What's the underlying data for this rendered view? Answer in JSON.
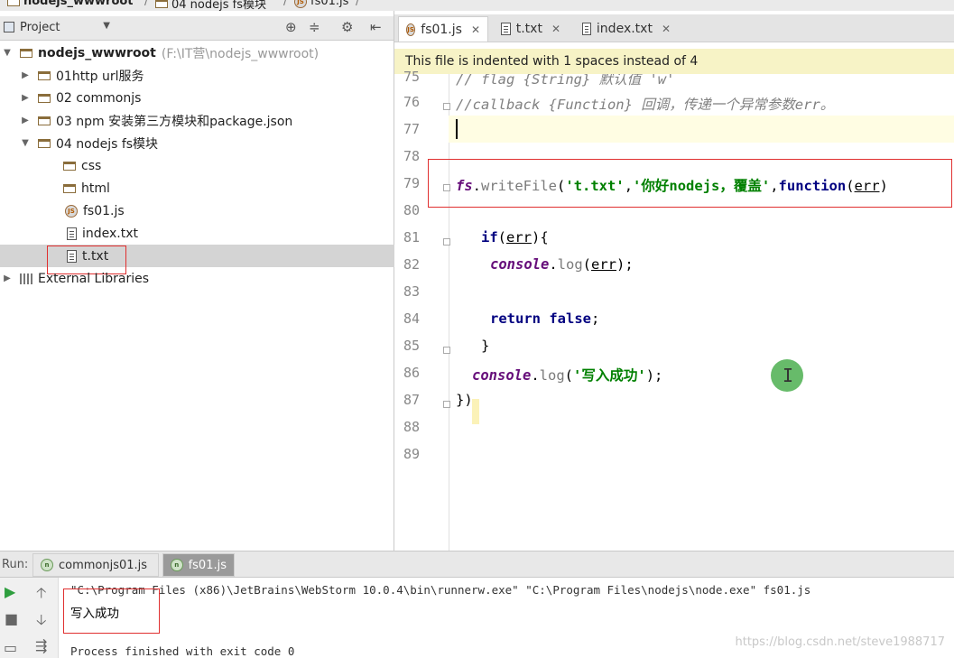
{
  "breadcrumb": [
    {
      "label": "nodejs_wwwroot",
      "icon": "folder-icon"
    },
    {
      "label": "04 nodejs fs模块",
      "icon": "folder-icon"
    },
    {
      "label": "fs01.js",
      "icon": "js-file-icon"
    }
  ],
  "project_panel": {
    "selector_label": "Project",
    "tree": [
      {
        "label": "nodejs_wwwroot",
        "note": "(F:\\IT营\\nodejs_wwwroot)",
        "icon": "folder-icon",
        "expanded": true,
        "level": 0
      },
      {
        "label": "01http url服务",
        "icon": "folder-icon",
        "level": 1
      },
      {
        "label": "02 commonjs",
        "icon": "folder-icon",
        "level": 1
      },
      {
        "label": "03 npm 安装第三方模块和package.json",
        "icon": "folder-icon",
        "level": 1
      },
      {
        "label": "04 nodejs fs模块",
        "icon": "folder-icon",
        "expanded": true,
        "level": 1
      },
      {
        "label": "css",
        "icon": "folder-icon",
        "level": 2
      },
      {
        "label": "html",
        "icon": "folder-icon",
        "level": 2
      },
      {
        "label": "fs01.js",
        "icon": "js-file-icon",
        "level": 2
      },
      {
        "label": "index.txt",
        "icon": "text-file-icon",
        "level": 2
      },
      {
        "label": "t.txt",
        "icon": "text-file-icon",
        "level": 2,
        "selected": true
      },
      {
        "label": "External Libraries",
        "icon": "library-icon",
        "level": 0
      }
    ]
  },
  "editor": {
    "tabs": [
      {
        "label": "fs01.js",
        "icon": "js-file-icon",
        "active": true
      },
      {
        "label": "t.txt",
        "icon": "text-file-icon"
      },
      {
        "label": "index.txt",
        "icon": "text-file-icon"
      }
    ],
    "notice": "This file is indented with 1 spaces instead of 4",
    "line_numbers": [
      "75",
      "76",
      "77",
      "78",
      "79",
      "80",
      "81",
      "82",
      "83",
      "84",
      "85",
      "86",
      "87",
      "88",
      "89"
    ],
    "code": {
      "l75": "//   flag           {String}       默认值 'w'",
      "l76": "//callback {Function}  回调，传递一个异常参数err。",
      "l79": {
        "obj": "fs",
        "dot": ".",
        "fn": "writeFile",
        "p1": "(",
        "s1": "'t.txt'",
        "c1": ",",
        "s2": "'你好nodejs，覆盖'",
        "c2": ",",
        "kw": "function",
        "p2": "(",
        "arg": "err",
        "p3": ")"
      },
      "l81": {
        "kw": "if",
        "p1": "(",
        "arg": "err",
        "p2": "){"
      },
      "l82": {
        "obj": "console",
        "dot": ".",
        "fn": "log",
        "p1": "(",
        "arg": "err",
        "p2": ");"
      },
      "l84": {
        "kw1": "return",
        "kw2": "false",
        "semi": ";"
      },
      "l85": "}",
      "l86": {
        "obj": "console",
        "dot": ".",
        "fn": "log",
        "p1": "(",
        "s": "'写入成功'",
        "p2": ");"
      },
      "l87": "})"
    }
  },
  "run_panel": {
    "label": "Run:",
    "tabs": [
      {
        "label": "commonjs01.js",
        "icon": "node-icon"
      },
      {
        "label": "fs01.js",
        "icon": "node-icon",
        "active": true
      }
    ],
    "console": [
      "\"C:\\Program Files (x86)\\JetBrains\\WebStorm 10.0.4\\bin\\runnerw.exe\" \"C:\\Program Files\\nodejs\\node.exe\" fs01.js",
      "写入成功",
      "Process finished with exit code 0"
    ]
  },
  "watermark": "https://blog.csdn.net/steve1988717"
}
